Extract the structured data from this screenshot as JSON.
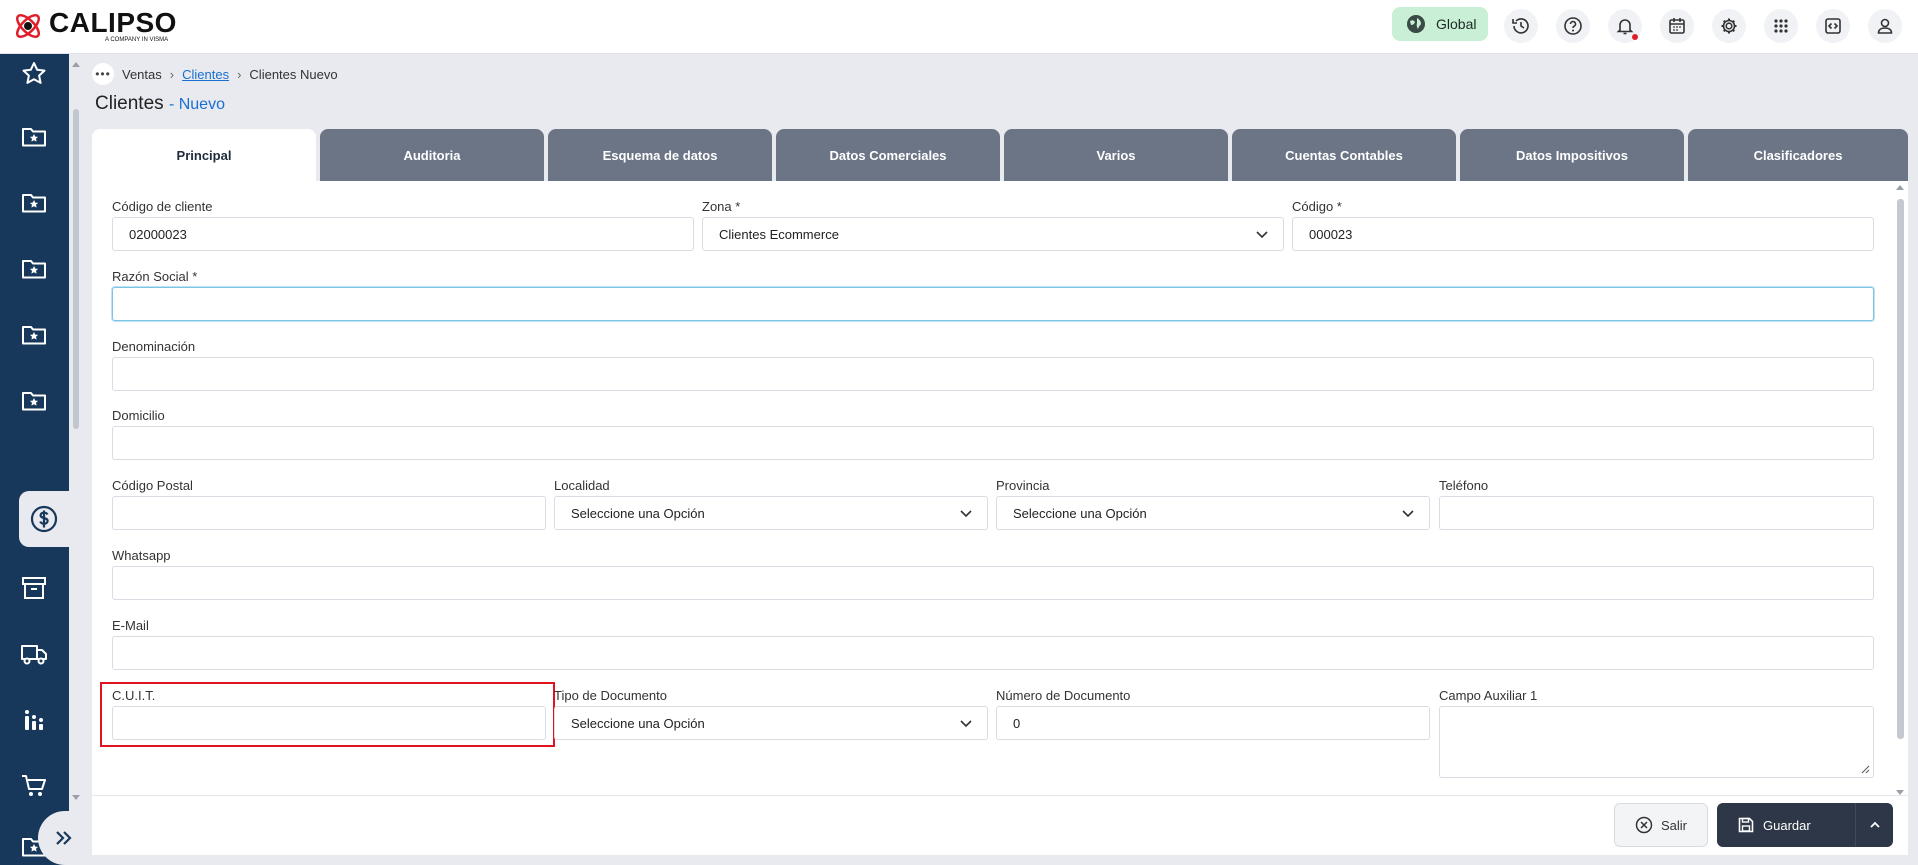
{
  "app": {
    "logo_name": "CALIPSO",
    "logo_tagline": "A COMPANY IN VISMA",
    "scope_label": "Global"
  },
  "topbar_icons": [
    "history-icon",
    "help-icon",
    "bell-icon",
    "calendar-icon",
    "gear-icon",
    "apps-grid-icon",
    "code-icon",
    "user-icon"
  ],
  "sidebar": {
    "items": [
      "star-icon",
      "folder-star-icon",
      "folder-star-icon",
      "folder-star-icon",
      "folder-star-icon",
      "folder-star-icon",
      "dollar-icon",
      "archive-icon",
      "truck-icon",
      "chart-icon",
      "cart-icon",
      "folder-star-icon"
    ],
    "active_index": 6
  },
  "breadcrumb": {
    "items": [
      "Ventas",
      "Clientes",
      "Clientes Nuevo"
    ]
  },
  "page": {
    "title": "Clientes",
    "subtitle": "- Nuevo"
  },
  "tabs": [
    "Principal",
    "Auditoria",
    "Esquema de datos",
    "Datos Comerciales",
    "Varios",
    "Cuentas Contables",
    "Datos Impositivos",
    "Clasificadores"
  ],
  "active_tab": "Principal",
  "form": {
    "codigo_cliente": {
      "label": "Código de cliente",
      "value": "02000023"
    },
    "zona": {
      "label": "Zona *",
      "value": "Clientes Ecommerce"
    },
    "codigo": {
      "label": "Código *",
      "value": "000023"
    },
    "razon_social": {
      "label": "Razón Social *",
      "value": ""
    },
    "denominacion": {
      "label": "Denominación",
      "value": ""
    },
    "domicilio": {
      "label": "Domicilio",
      "value": ""
    },
    "codigo_postal": {
      "label": "Código Postal",
      "value": ""
    },
    "localidad": {
      "label": "Localidad",
      "value": "Seleccione una Opción"
    },
    "provincia": {
      "label": "Provincia",
      "value": "Seleccione una Opción"
    },
    "telefono": {
      "label": "Teléfono",
      "value": ""
    },
    "whatsapp": {
      "label": "Whatsapp",
      "value": ""
    },
    "email": {
      "label": "E-Mail",
      "value": ""
    },
    "cuit": {
      "label": "C.U.I.T.",
      "value": ""
    },
    "tipo_documento": {
      "label": "Tipo de Documento",
      "value": "Seleccione una Opción"
    },
    "numero_documento": {
      "label": "Número de Documento",
      "value": "0"
    },
    "campo_auxiliar_1": {
      "label": "Campo Auxiliar 1",
      "value": ""
    }
  },
  "footer": {
    "exit_label": "Salir",
    "save_label": "Guardar"
  },
  "colors": {
    "sidebar": "#17385a",
    "tab_inactive": "#6b7585",
    "accent_link": "#1a6fd1",
    "global_pill": "#c9f0d6",
    "highlight": "#e0141e",
    "save_button": "#2d3748"
  }
}
